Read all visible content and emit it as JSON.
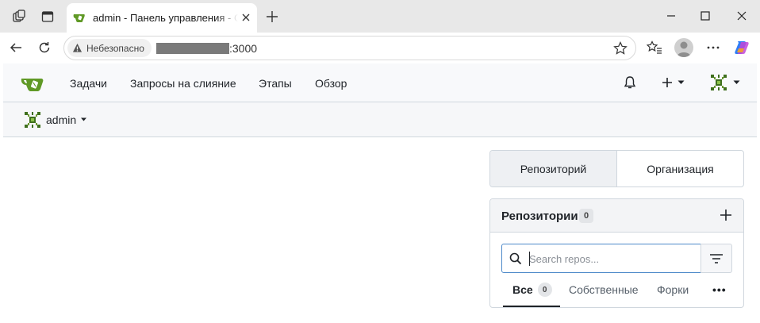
{
  "browser": {
    "tab_title": "admin - Панель управления - Gitea",
    "security_label": "Небезопасно",
    "url_suffix": ":3000"
  },
  "nav": {
    "links": [
      "Задачи",
      "Запросы на слияние",
      "Этапы",
      "Обзор"
    ],
    "user_initials": "admin"
  },
  "context": {
    "user": "admin"
  },
  "switcher": {
    "items": [
      "Репозиторий",
      "Организация"
    ],
    "active": "Репозиторий"
  },
  "repos": {
    "title": "Репозитории",
    "count": "0",
    "search_placeholder": "Search repos...",
    "tabs": [
      {
        "label": "Все",
        "count": "0"
      },
      {
        "label": "Собственные"
      },
      {
        "label": "Форки"
      }
    ],
    "more": "•••"
  },
  "colors": {
    "gitea_green": "#609926",
    "link_focus": "#4d89c9"
  }
}
